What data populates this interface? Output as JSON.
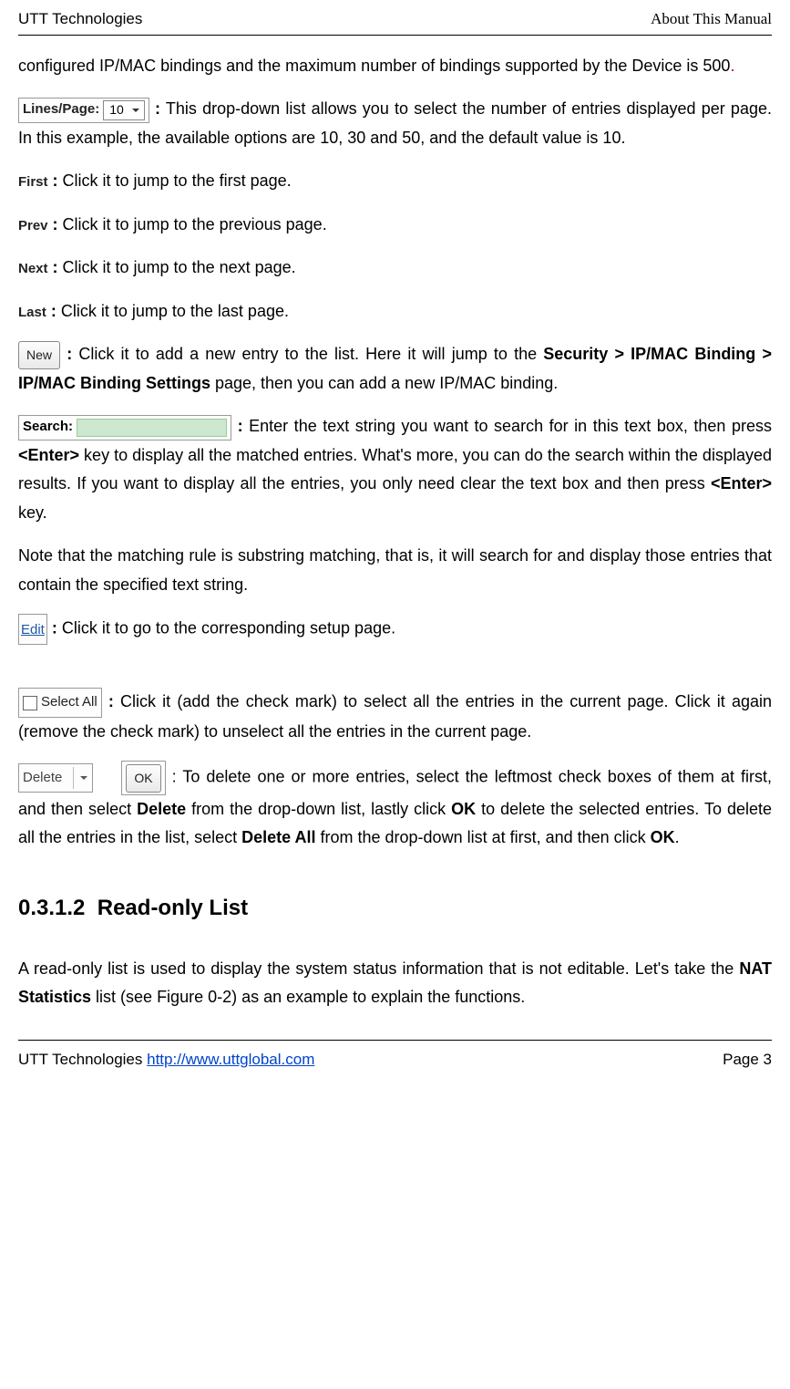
{
  "header": {
    "left": "UTT Technologies",
    "right": "About This Manual"
  },
  "intro": {
    "part1": "configured IP/MAC bindings and the maximum number of bindings supported by the Device is 500",
    "dot": "."
  },
  "linesPer": {
    "label": "Lines/Page:",
    "value": "10",
    "desc": " This drop-down list allows you to select the number of entries displayed per page. In this example, the available options are 10, 30 and 50, and the default value is 10."
  },
  "pager": {
    "first": {
      "label": "First",
      "desc": " Click it to jump to the first page."
    },
    "prev": {
      "label": "Prev",
      "desc": " Click it to jump to the previous page."
    },
    "next": {
      "label": "Next",
      "desc": " Click it to jump to the next page."
    },
    "last": {
      "label": "Last",
      "desc": " Click it to jump to the last page."
    }
  },
  "newBtn": {
    "label": "New",
    "desc_a": " Click it to add a new entry to the list. Here it will jump to the ",
    "desc_b": "Security > IP/MAC Binding > IP/MAC Binding Settings",
    "desc_c": " page, then you can add a new IP/MAC binding."
  },
  "search": {
    "label": "Search:",
    "desc_a": " Enter the text string you want to search for in this text box, then press ",
    "enter1": "<Enter>",
    "desc_b": " key to display all the matched entries. What's more, you can do the search within the displayed results. If you want to display all the entries, you only need clear the text box and then press ",
    "enter2": "<Enter>",
    "desc_c": " key.",
    "note": "Note that the matching rule is substring matching, that is, it will search for and display those entries that contain the specified text string."
  },
  "edit": {
    "label": "Edit",
    "desc": " Click it to go to the corresponding setup page."
  },
  "selectAll": {
    "label": "Select All",
    "desc": " Click it (add the check mark) to select all the entries in the current page. Click it again (remove the check mark) to unselect all the entries in the current page."
  },
  "deleteOk": {
    "deleteLabel": "Delete",
    "okLabel": "OK",
    "desc_a": " : To delete one or more entries, select the leftmost check boxes of them at first, and then select ",
    "b1": "Delete",
    "desc_b": " from the drop-down list, lastly click ",
    "b2": "OK",
    "desc_c": " to delete the selected entries. To delete all the entries in the list, select ",
    "b3": "Delete All",
    "desc_d": " from the drop-down list at first, and then click ",
    "b4": "OK",
    "desc_e": "."
  },
  "section": {
    "number": "0.3.1.2",
    "title": "Read-only List",
    "body_a": "A read-only list is used to display the system status information that is not editable. Let's take the ",
    "body_b": "NAT Statistics",
    "body_c": " list (see Figure 0-2) as an example to explain the functions."
  },
  "footer": {
    "company": "UTT Technologies ",
    "url": "http://www.uttglobal.com",
    "page": "Page 3"
  }
}
